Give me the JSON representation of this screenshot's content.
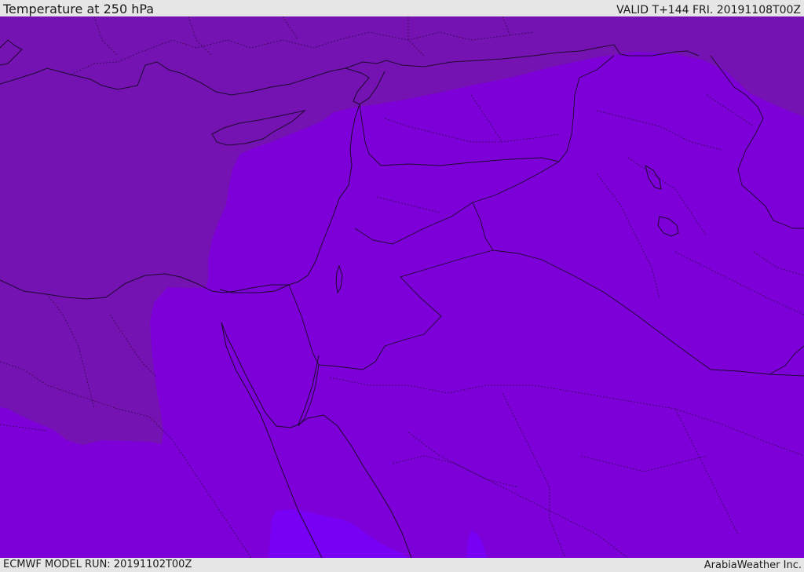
{
  "header": {
    "title": "Temperature at 250 hPa",
    "valid": "VALID T+144 FRI. 20191108T00Z"
  },
  "footer": {
    "model_run": "ECMWF MODEL RUN: 20191102T00Z",
    "credit": "ArabiaWeather Inc."
  },
  "colors": {
    "background": "#e6e6e6",
    "band_dark": "#7512b2",
    "band_mid": "#7d00d9",
    "band_light": "#7800f5",
    "lines": "#1c0a2e"
  }
}
